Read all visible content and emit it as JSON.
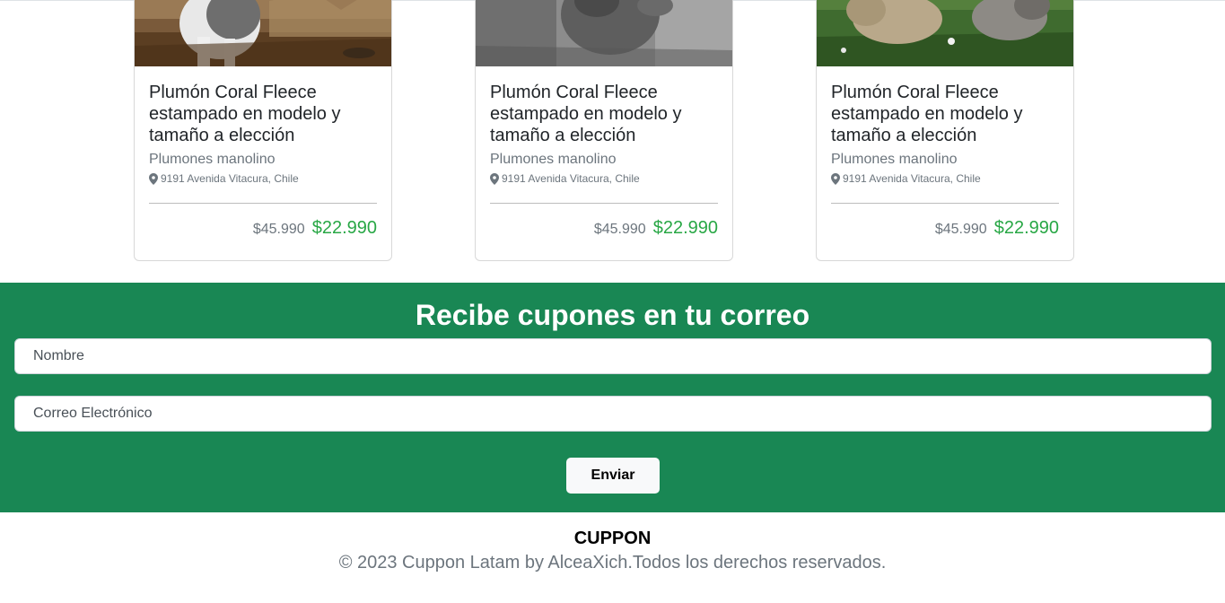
{
  "products": [
    {
      "image_alt": "husky-puppy-photo",
      "title": "Plumón Coral Fleece estampado en modelo y tamaño a elección",
      "vendor": "Plumones manolino",
      "address": "9191 Avenida Vitacura, Chile",
      "old_price": "$45.990",
      "new_price": "$22.990"
    },
    {
      "image_alt": "gray-dog-photo",
      "title": "Plumón Coral Fleece estampado en modelo y tamaño a elección",
      "vendor": "Plumones manolino",
      "address": "9191 Avenida Vitacura, Chile",
      "old_price": "$45.990",
      "new_price": "$22.990"
    },
    {
      "image_alt": "dogs-on-grass-photo",
      "title": "Plumón Coral Fleece estampado en modelo y tamaño a elección",
      "vendor": "Plumones manolino",
      "address": "9191 Avenida Vitacura, Chile",
      "old_price": "$45.990",
      "new_price": "$22.990"
    }
  ],
  "newsletter": {
    "title": "Recibe cupones en tu correo",
    "name_placeholder": "Nombre",
    "email_placeholder": "Correo Electrónico",
    "submit_label": "Enviar"
  },
  "footer": {
    "brand": "CUPPON",
    "copyright": "© 2023 Cuppon Latam by AlceaXich.Todos los derechos reservados."
  },
  "colors": {
    "newsletter_bg": "#198754",
    "sale_price": "#28a745",
    "muted_text": "#6c757d"
  },
  "icons": {
    "address": "map-pin-icon"
  }
}
